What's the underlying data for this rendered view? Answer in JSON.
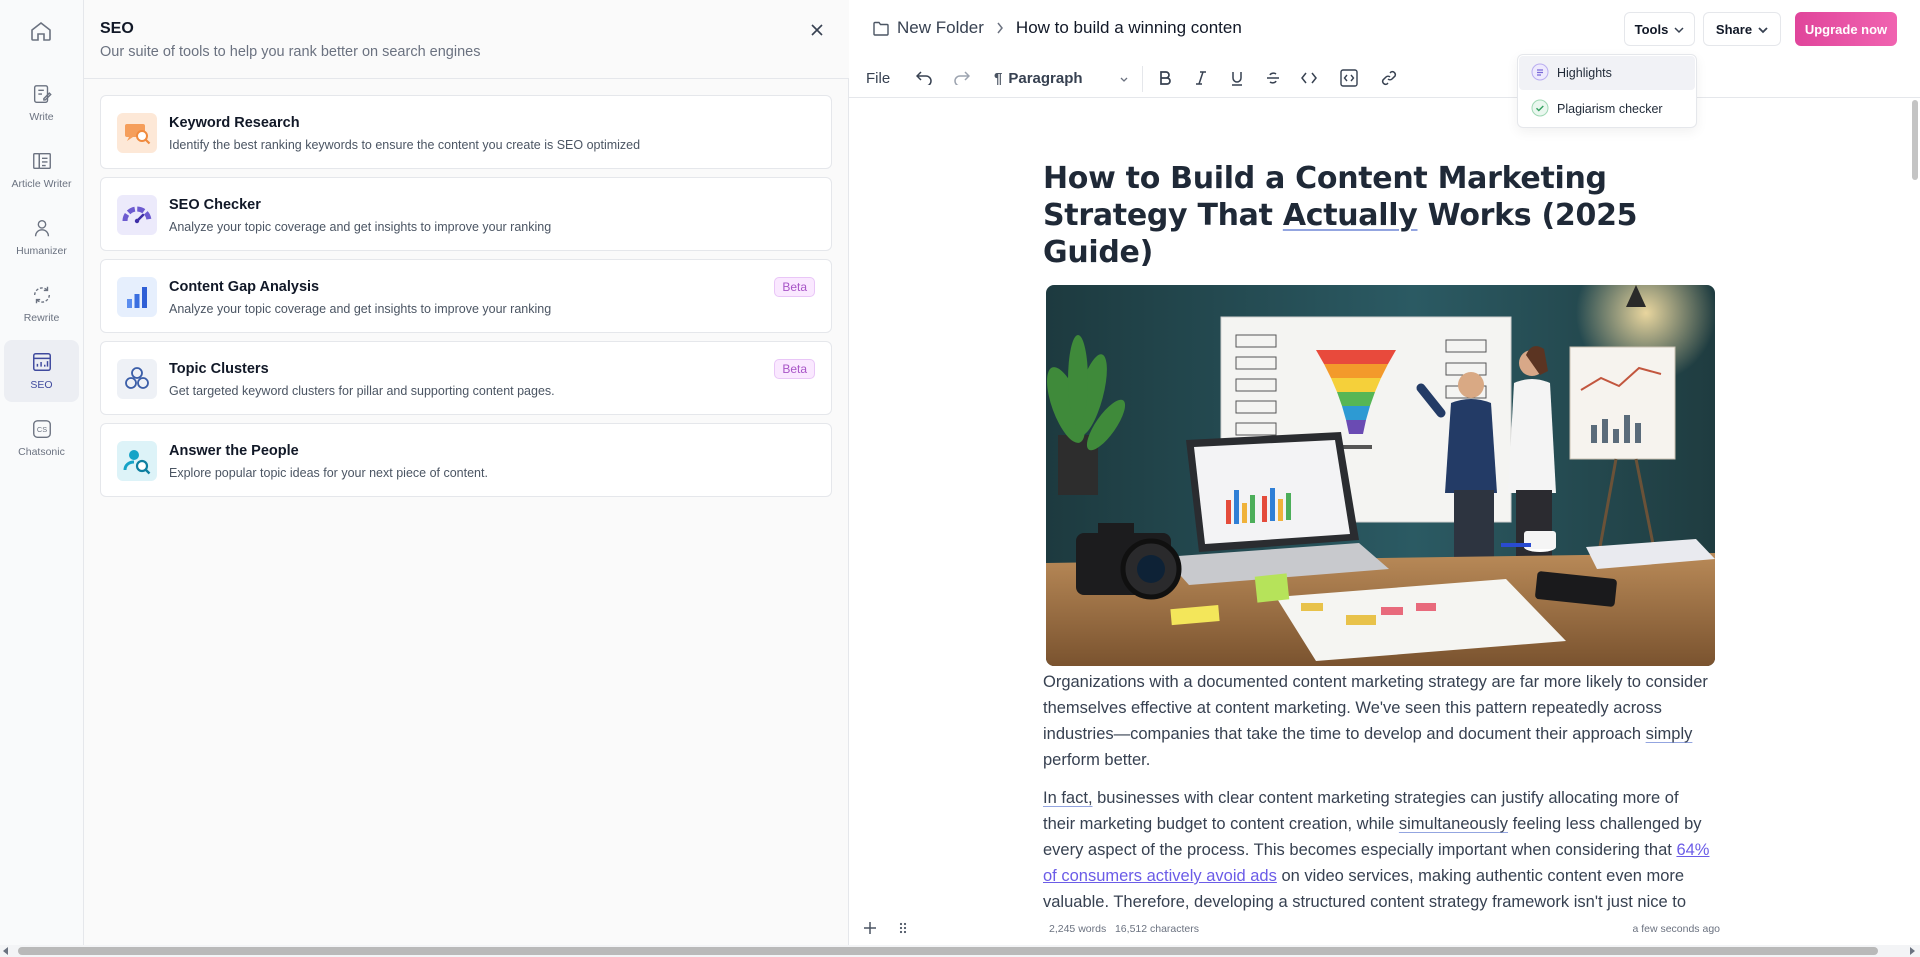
{
  "rail": {
    "home_icon": "home-icon",
    "items": [
      {
        "label": "Write",
        "icon": "write-icon"
      },
      {
        "label": "Article Writer",
        "icon": "article-writer-icon"
      },
      {
        "label": "Humanizer",
        "icon": "humanizer-icon"
      },
      {
        "label": "Rewrite",
        "icon": "rewrite-icon"
      },
      {
        "label": "SEO",
        "icon": "seo-icon",
        "active": true
      },
      {
        "label": "Chatsonic",
        "icon": "chatsonic-icon"
      }
    ],
    "chatsonic_glyph": "CS"
  },
  "seo_panel": {
    "title": "SEO",
    "subtitle": "Our suite of tools to help you rank better on search engines",
    "cards": [
      {
        "title": "Keyword Research",
        "desc": "Identify the best ranking keywords to ensure the content you create is SEO optimized",
        "badge": ""
      },
      {
        "title": "SEO Checker",
        "desc": "Analyze your topic coverage and get insights to improve your ranking",
        "badge": ""
      },
      {
        "title": "Content Gap Analysis",
        "desc": "Analyze your topic coverage and get insights to improve your ranking",
        "badge": "Beta"
      },
      {
        "title": "Topic Clusters",
        "desc": "Get targeted keyword clusters for pillar and supporting content pages.",
        "badge": "Beta"
      },
      {
        "title": "Answer the People",
        "desc": "Explore popular topic ideas for your next piece of content.",
        "badge": ""
      }
    ]
  },
  "header": {
    "folder": "New Folder",
    "doc_title": "How to build a winning content",
    "tools_label": "Tools",
    "share_label": "Share",
    "upgrade_label": "Upgrade now"
  },
  "toolbar": {
    "file_label": "File",
    "block_style": "Paragraph"
  },
  "tools_menu": {
    "items": [
      {
        "label": "Highlights",
        "icon": "highlights-icon"
      },
      {
        "label": "Plagiarism checker",
        "icon": "plagiarism-check-icon"
      }
    ]
  },
  "document": {
    "title_a": "How to Build a Content Marketing Strategy That ",
    "title_b": "Actually",
    "title_c": " Works (2025 Guide)",
    "p1_a": " Organizations with a documented content marketing strategy are far more likely to consider themselves effective at content marketing. We've seen this pattern repeatedly across industries—companies that take the time to develop and document their approach ",
    "p1_b": "simply",
    "p1_c": " perform better.",
    "p2_a": "In fact,",
    "p2_b": " businesses with clear content marketing strategies can justify allocating more of their marketing budget to content creation, while ",
    "p2_c": "simultaneously",
    "p2_d": " feeling less challenged by every aspect of the process. This becomes especially important when considering that ",
    "p2_link": "64% of consumers actively avoid ads",
    "p2_e": " on video services, making authentic content even more valuable. Therefore, developing a structured content strategy framework isn't just nice to have—it's essential for connecting with modern audiences throughout"
  },
  "footer": {
    "words": "2,245 words",
    "characters": "16,512 characters",
    "saved": "a few seconds ago"
  },
  "colors": {
    "accent": "#3f4a9e",
    "upgrade": "#e8519f",
    "link": "#6b5ce7",
    "beta": "#a855c7"
  }
}
